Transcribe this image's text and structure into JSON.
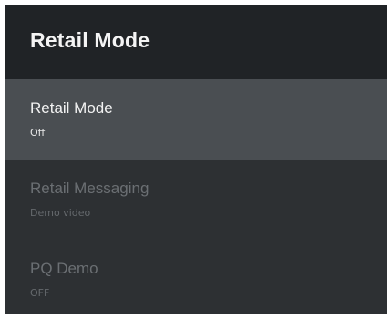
{
  "header": {
    "title": "Retail Mode"
  },
  "menu": {
    "items": [
      {
        "label": "Retail Mode",
        "value": "Off",
        "state": "selected"
      },
      {
        "label": "Retail Messaging",
        "value": "Demo video",
        "state": "disabled"
      },
      {
        "label": "PQ Demo",
        "value": "OFF",
        "state": "disabled"
      }
    ]
  }
}
